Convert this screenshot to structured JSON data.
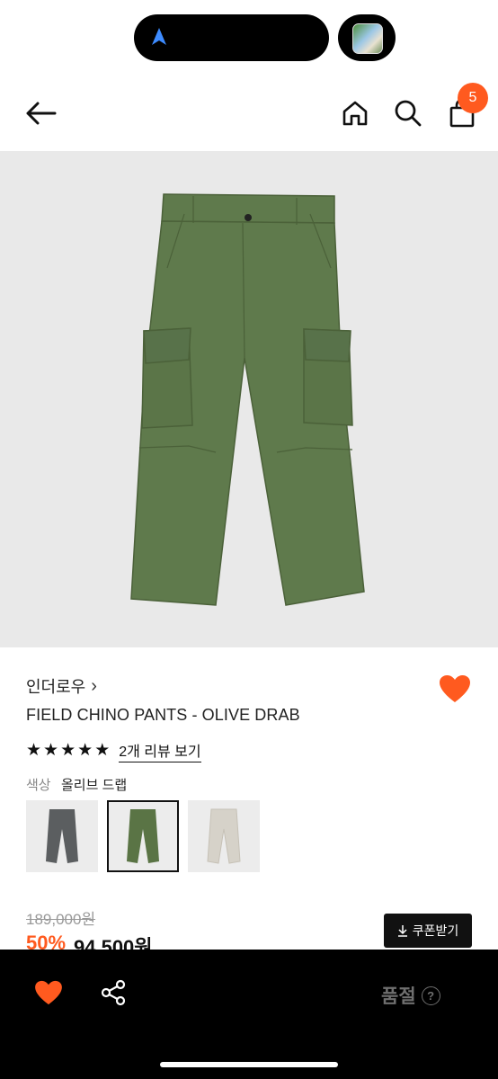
{
  "header": {
    "cart_count": "5"
  },
  "product": {
    "brand": "인더로우",
    "brand_chevron": "›",
    "name": "FIELD CHINO PANTS - OLIVE DRAB",
    "stars": 5,
    "review_link": "2개 리뷰 보기",
    "color_label": "색상",
    "color_value": "올리브 드랩",
    "swatches": [
      {
        "color": "#5b5e60",
        "selected": false
      },
      {
        "color": "#5a7445",
        "selected": true
      },
      {
        "color": "#d6d2c9",
        "selected": false
      }
    ],
    "original_price": "189,000원",
    "discount": "50%",
    "sale_price": "94,500원",
    "coupon_label": "쿠폰받기"
  },
  "bottom_bar": {
    "soldout_label": "품절",
    "help_glyph": "?"
  },
  "colors": {
    "accent": "#ff5a1f",
    "pants": "#5f7a4c"
  },
  "icons": [
    "back-arrow-icon",
    "home-icon",
    "search-icon",
    "cart-icon",
    "heart-icon",
    "share-icon",
    "star-icon",
    "download-icon",
    "help-icon",
    "navigation-arrow-icon"
  ]
}
